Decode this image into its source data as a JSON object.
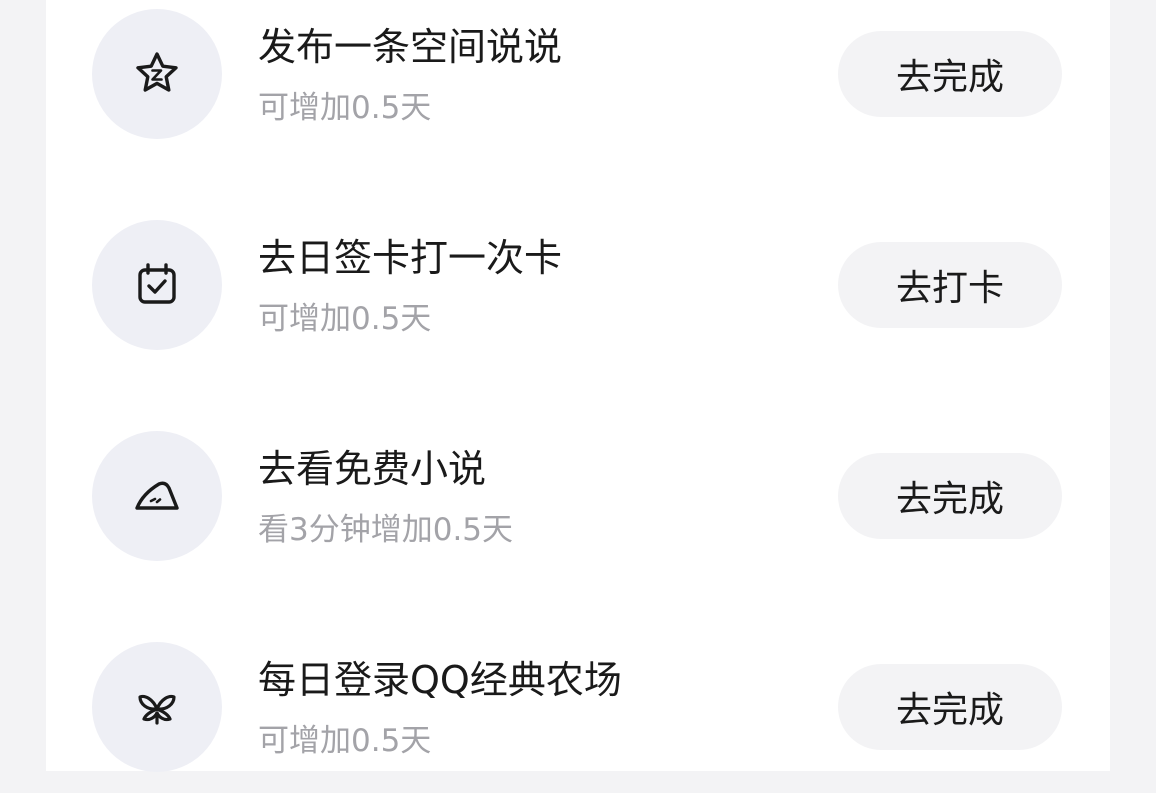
{
  "tasks": [
    {
      "icon": "star-icon",
      "title": "发布一条空间说说",
      "subtitle": "可增加0.5天",
      "button": "去完成"
    },
    {
      "icon": "calendar-check-icon",
      "title": "去日签卡打一次卡",
      "subtitle": "可增加0.5天",
      "button": "去打卡"
    },
    {
      "icon": "novel-icon",
      "title": "去看免费小说",
      "subtitle": "看3分钟增加0.5天",
      "button": "去完成"
    },
    {
      "icon": "sprout-icon",
      "title": "每日登录QQ经典农场",
      "subtitle": "可增加0.5天",
      "button": "去完成"
    }
  ]
}
